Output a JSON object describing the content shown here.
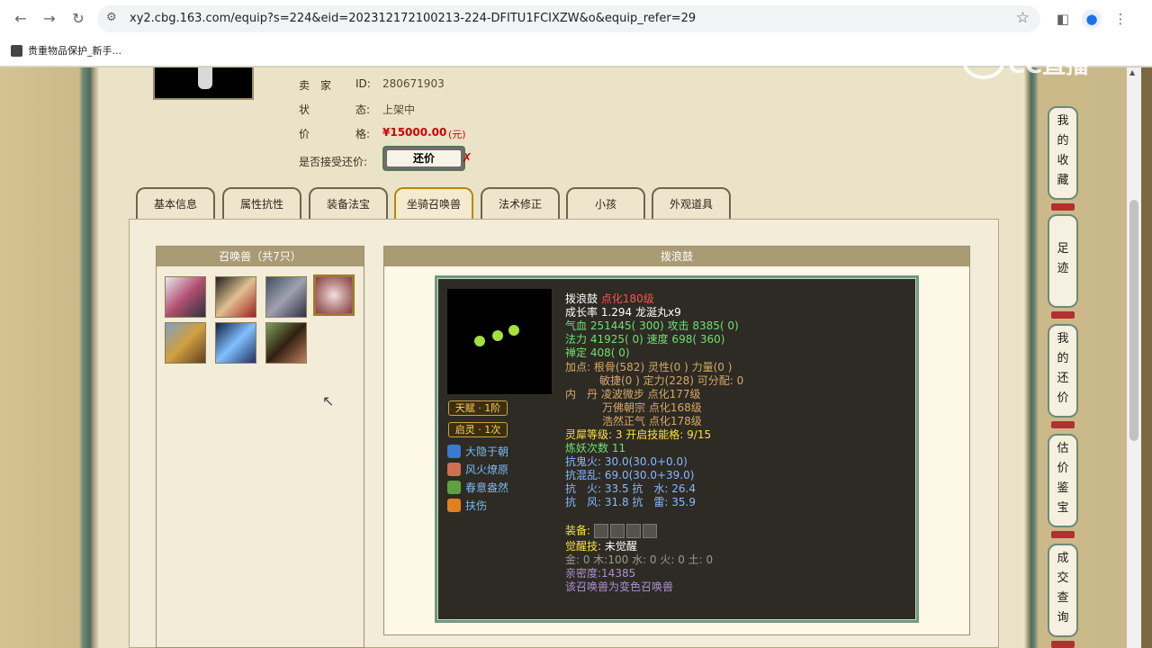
{
  "browser": {
    "url": "xy2.cbg.163.com/equip?s=224&eid=202312172100213-224-DFITU1FCIXZW&o&equip_refer=29",
    "bookmark": "贵重物品保护_新手..."
  },
  "watermark": "CC直播",
  "info": {
    "seller_label": "卖　家",
    "id_label": "ID:",
    "id_value": "280671903",
    "status_label1": "状",
    "status_label2": "态:",
    "status_value": "上架中",
    "price_label1": "价",
    "price_label2": "格:",
    "price_value": "¥15000.00",
    "price_unit": "(元)",
    "bargain_label": "是否接受还价:",
    "bargain_button": "还价"
  },
  "tabs": [
    "基本信息",
    "属性抗性",
    "装备法宝",
    "坐骑召唤兽",
    "法术修正",
    "小孩",
    "外观道具"
  ],
  "pet_panel": {
    "title": "召唤兽（共7只）"
  },
  "detail_panel": {
    "title": "拨浪鼓"
  },
  "badges": {
    "talent": "天赋 · 1阶",
    "awaken": "启灵 · 1次"
  },
  "skills": [
    "大隐于朝",
    "风火燎原",
    "春意盎然",
    "扶伤"
  ],
  "stats": {
    "name": "拨浪鼓",
    "level": "点化180级",
    "growth": "成长率 1.294 龙涎丸x9",
    "hp": "气血 251445( 300) 攻击 8385( 0)",
    "mp": "法力 41925( 0) 速度 698( 360)",
    "zen": "禅定 408( 0)",
    "points1": "加点: 根骨(582) 灵性(0 ) 力量(0 )",
    "points2": "敏捷(0 ) 定力(228) 可分配: 0",
    "neidan1": "内　丹 凌波微步 点化177级",
    "neidan2": "万佛朝宗 点化168级",
    "neidan3": "浩然正气 点化178级",
    "lingxi": "灵犀等级: 3 开启技能格: 9/15",
    "lianyao": "炼妖次数 11",
    "resist_ghost": "抗鬼火: 30.0(30.0+0.0)",
    "resist_chaos": "抗混乱: 69.0(30.0+39.0)",
    "resist_fire_water": "抗　火: 33.5 抗　水: 26.4",
    "resist_wind_thunder": "抗　风: 31.8 抗　雷: 35.9",
    "equip_label": "装备:",
    "awaken_label": "觉醒技:",
    "awaken_value": "未觉醒",
    "elements": "金: 0 木:100 水: 0 火: 0 土: 0",
    "intimacy": "亲密度:14385",
    "variant": "该召唤兽为变色召唤兽"
  },
  "sidebar": [
    "我的收藏",
    "足迹",
    "我的还价",
    "估价鉴宝",
    "成交查询"
  ]
}
